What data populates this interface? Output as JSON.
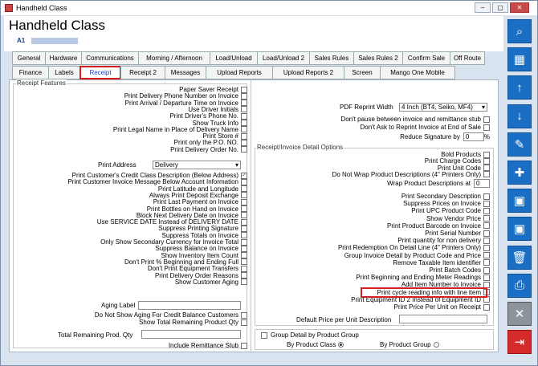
{
  "window": {
    "title": "Handheld Class",
    "min": "–",
    "max": "▢",
    "close": "✕"
  },
  "header": {
    "title": "Handheld Class",
    "code": "A1"
  },
  "tabs_row1": [
    "General",
    "Hardware",
    "Communications",
    "Morning / Afternoon",
    "Load/Unload",
    "Load/Unload 2",
    "Sales Rules",
    "Sales Rules 2",
    "Confirm Sale",
    "Off Route"
  ],
  "tabs_row2": [
    "Finance",
    "Labels",
    "Receipt",
    "Receipt 2",
    "Messages",
    "Upload Reports",
    "Upload Reports 2",
    "Screen",
    "Mango One Mobile"
  ],
  "selected_tab": "Receipt",
  "left": {
    "group": "Receipt Features",
    "rows": [
      "Paper Saver Receipt",
      "Print Delivery Phone Number on Invoice",
      "Print Arrival / Departure Time on Invoice",
      "Use Driver Initials",
      "Print Driver's Phone No.",
      "Show Truck Info",
      "Print Legal Name in Place of Delivery Name",
      "Print Store #",
      "Print only the P.O. NO.",
      "Print Delivery Order No."
    ],
    "print_address_label": "Print Address",
    "print_address_value": "Delivery",
    "rows2": [
      "Print Customer's Credit Class Description (Below Address)",
      "Print Customer Invoice Message Below Account Information",
      "Print Latitude and Longitude",
      "Always Print Deposit Exchange",
      "Print Last Payment on Invoice",
      "Print Bottles on Hand on Invoice",
      "Block Next Delivery Date on Invoice",
      "Use SERVICE DATE Instead of DELIVERY DATE",
      "Suppress Printing Signature",
      "Suppress Totals on Invoice",
      "Only Show Secondary Currency for Invoice Total",
      "Suppress Balance on Invoice",
      "Show Inventory Item Count",
      "Don't Print % Beginning and Ending Full",
      "Don't Print Equipment Transfers",
      "Print Delivery Order Reasons",
      "Show Customer Aging"
    ],
    "aging_label": "Aging Label",
    "rows3": [
      "Do Not Show Aging For Credit Balance Customers",
      "Show Total Remaining Product Qty"
    ],
    "total_remaining_label": "Total Remaining Prod. Qty",
    "include_remittance": "Include Remittance Stub"
  },
  "right": {
    "pdf_label": "PDF Reprint Width",
    "pdf_value": "4 Inch (BT4, Seiko, MF4)",
    "rows_top": [
      "Don't pause between invoice and remittance stub",
      "Don't Ask to Reprint Invoice at End of Sale"
    ],
    "reduce_label": "Reduce Signature by",
    "reduce_value": "0",
    "reduce_unit": "%",
    "group": "Receipt/Invoice Detail Options",
    "rows_a": [
      "Bold Products",
      "Print Charge Codes",
      "Print Unit Code",
      "Do Not Wrap Product Descriptions (4\" Printers Only)"
    ],
    "wrap_label": "Wrap Product Descriptions at",
    "wrap_value": "0",
    "rows_b": [
      "Print Secondary Description",
      "Suppress Prices on Invoice",
      "Print UPC Product Code",
      "Show Vendor Price",
      "Print Product Barcode on Invoice",
      "Print Serial Number",
      "Print quantity for non delivery",
      "Print Redemption On Detail Line (4\" Printers Only)",
      "Group Invoice Detail by Product Code and Price",
      "Remove Taxable Item identifier",
      "Print Batch Codes",
      "Print Beginning and Ending Meter Readings",
      "Add Item Number to Invoice",
      "Print cycle reading info with line item",
      "Print Equipment ID 2 Instead of Equipment ID",
      "Print Price Per Unit on Receipt"
    ],
    "default_price_label": "Default Price per Unit Description",
    "group_detail_label": "Group Detail by Product Group",
    "by_class": "By Product Class",
    "by_group": "By Product Group"
  },
  "side_buttons": [
    "search",
    "grid",
    "up",
    "down",
    "edit",
    "add",
    "save-new",
    "save",
    "delete",
    "print",
    "cancel",
    "exit"
  ]
}
